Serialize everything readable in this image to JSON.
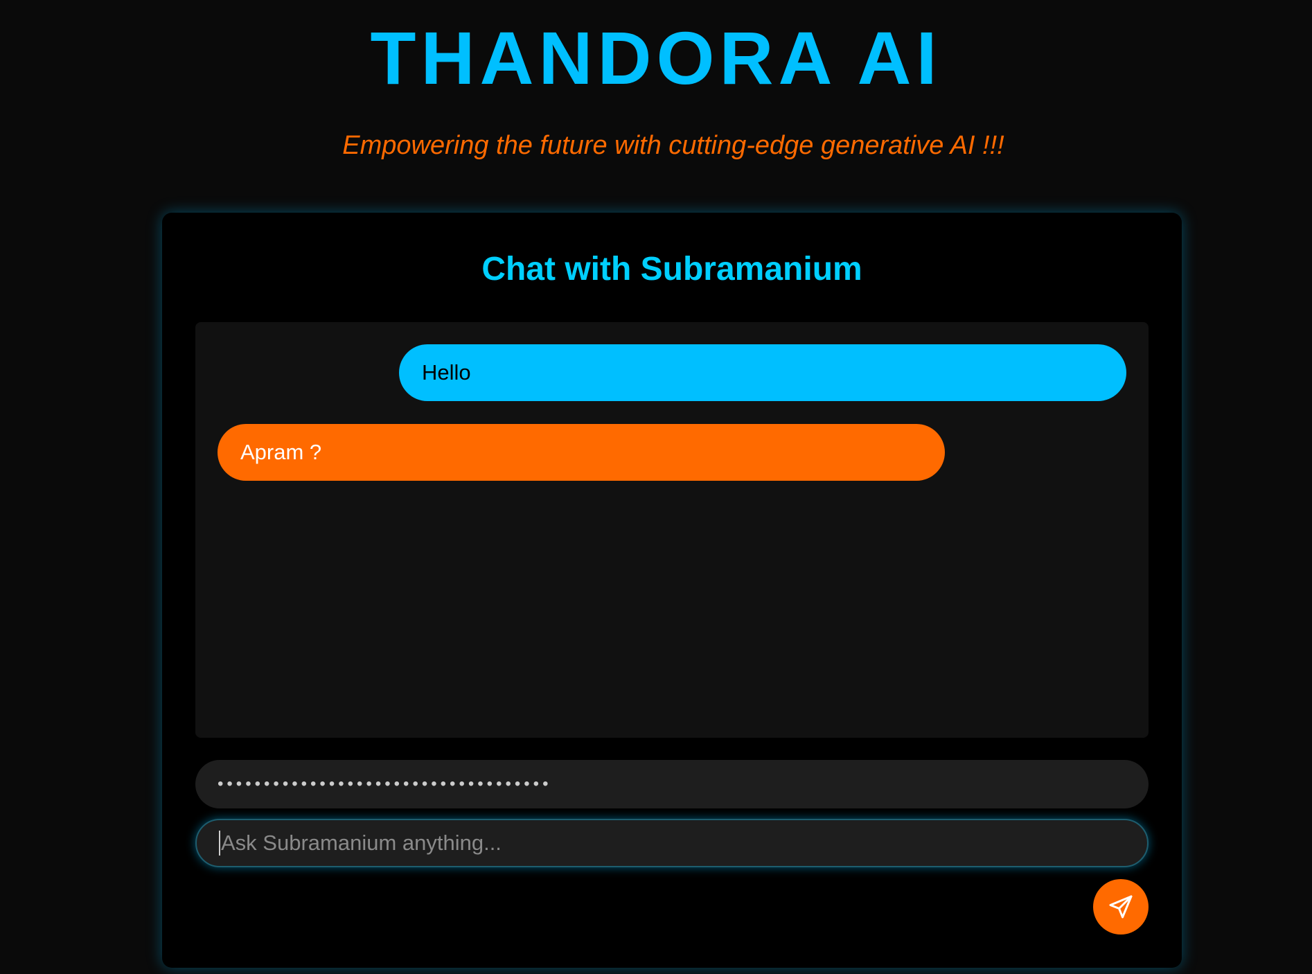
{
  "header": {
    "title": "THANDORA AI",
    "tagline": "Empowering the future with cutting-edge generative AI !!!"
  },
  "chat": {
    "heading": "Chat with Subramanium",
    "messages": [
      {
        "role": "user",
        "text": "Hello"
      },
      {
        "role": "assistant",
        "text": "Apram ?"
      }
    ]
  },
  "api_key_field": {
    "masked_value": "••••••••••••••••••••••••••••••••••••"
  },
  "message_input": {
    "placeholder": "Ask Subramanium anything..."
  },
  "send_button": {
    "icon": "send-icon"
  },
  "colors": {
    "background": "#0a0a0a",
    "title": "#00bfff",
    "tagline": "#ff6a00",
    "user_bubble": "#00bfff",
    "bot_bubble": "#ff6a00",
    "send_button": "#ff6a00"
  }
}
